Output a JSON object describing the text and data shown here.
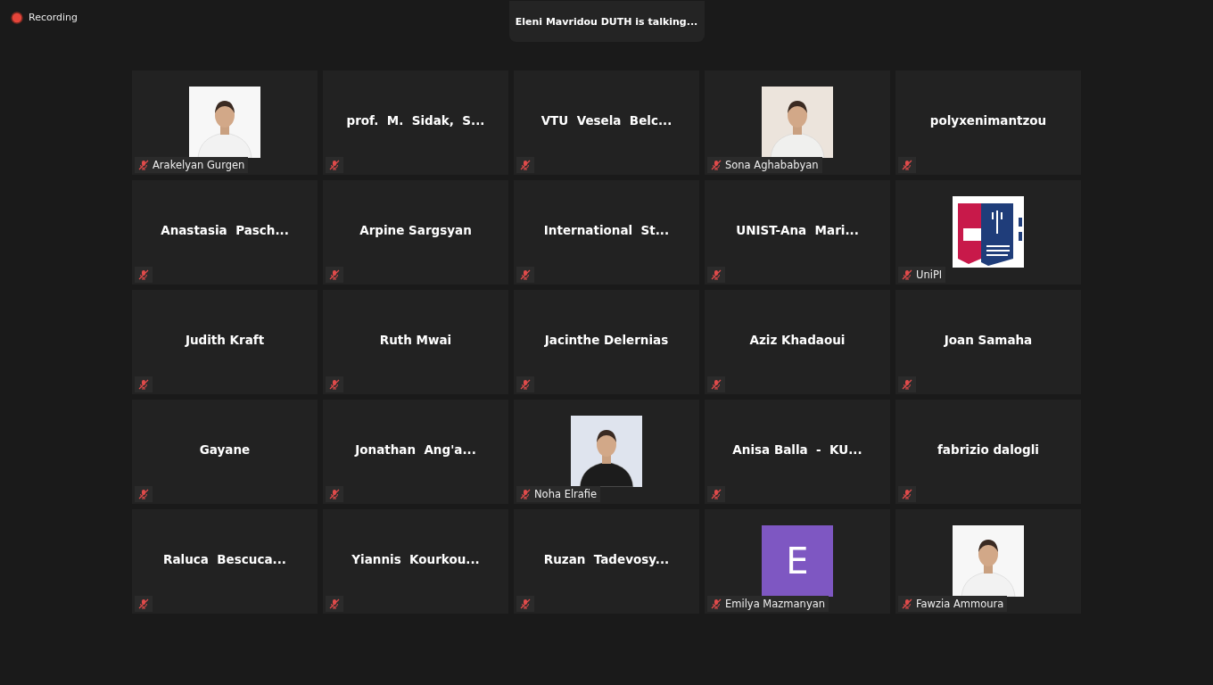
{
  "recording": {
    "label": "Recording",
    "on": true
  },
  "talking_banner": "Eleni Mavridou DUTH is talking...",
  "tiles": [
    {
      "name": "Arakelyan Gurgen",
      "muted": true
    },
    {
      "kind": "name",
      "name": "prof.  M.  Sidak,  S...",
      "muted": true
    },
    {
      "kind": "name",
      "name": "VTU  Vesela  Belc...",
      "muted": true
    },
    {
      "name": "Sona Aghababyan",
      "muted": true
    },
    {
      "kind": "name",
      "name": "polyxenimantzou",
      "muted": true
    },
    {
      "kind": "name",
      "name": "Anastasia  Pasch...",
      "muted": true
    },
    {
      "kind": "name",
      "name": "Arpine Sargsyan",
      "muted": true
    },
    {
      "kind": "name",
      "name": "International  St...",
      "muted": true
    },
    {
      "kind": "name",
      "name": "UNIST-Ana  Mari...",
      "muted": true
    },
    {
      "kind": "logo",
      "name": "UniPI",
      "muted": true
    },
    {
      "kind": "name",
      "name": "Judith Kraft",
      "muted": true
    },
    {
      "kind": "name",
      "name": "Ruth Mwai",
      "muted": true
    },
    {
      "kind": "name",
      "name": "Jacinthe Delernias",
      "muted": true
    },
    {
      "kind": "name",
      "name": "Aziz Khadaoui",
      "muted": true
    },
    {
      "kind": "name",
      "name": "Joan Samaha",
      "muted": true
    },
    {
      "kind": "name",
      "name": "Gayane",
      "muted": true
    },
    {
      "kind": "name",
      "name": "Jonathan  Ang'a...",
      "muted": true
    },
    {
      "name": "Noha Elrafie",
      "muted": true
    },
    {
      "kind": "name",
      "name": "Anisa Balla  -  KU...",
      "muted": true
    },
    {
      "kind": "name",
      "name": "fabrizio dalogli",
      "muted": true
    },
    {
      "kind": "name",
      "name": "Raluca  Bescuca...",
      "muted": true
    },
    {
      "kind": "name",
      "name": "Yiannis  Kourkou...",
      "muted": true
    },
    {
      "kind": "name",
      "name": "Ruzan  Tadevosy...",
      "muted": true
    },
    {
      "kind": "avatar",
      "name": "Emilya Mazmanyan",
      "muted": true,
      "initial": "E",
      "color": "#7e57c2"
    },
    {
      "name": "Fawzia Ammoura",
      "muted": true
    }
  ]
}
